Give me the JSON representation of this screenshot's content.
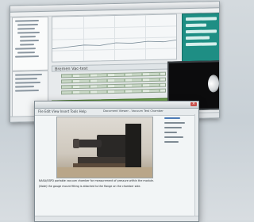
{
  "back_window": {
    "sub_header": "Bremen Vac-test",
    "accent_teal": "#1e8e84",
    "accent_green": "#6fa34c"
  },
  "front_window": {
    "title": "Document Viewer - Vacuum Test Chamber",
    "close_glyph": "×",
    "menu": "File  Edit  View  Insert  Tools  Help",
    "caption_line1": "NASA/SSPD portable vacuum chamber for measurement of pressure within the module.",
    "caption_line2": "(Note) the gauge mount fitting is attached to the flange on the chamber side."
  }
}
